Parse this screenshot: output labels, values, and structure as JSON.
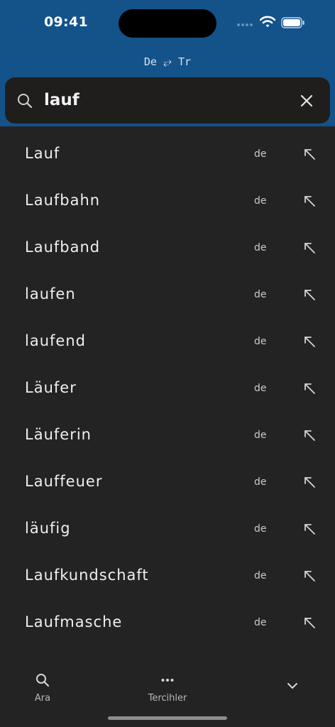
{
  "status_bar": {
    "time": "09:41"
  },
  "header": {
    "language_pair": "De ⥂ Tr"
  },
  "search": {
    "value": "lauf"
  },
  "results": [
    {
      "word": "Lauf",
      "lang": "de"
    },
    {
      "word": "Laufbahn",
      "lang": "de"
    },
    {
      "word": "Laufband",
      "lang": "de"
    },
    {
      "word": "laufen",
      "lang": "de"
    },
    {
      "word": "laufend",
      "lang": "de"
    },
    {
      "word": "Läufer",
      "lang": "de"
    },
    {
      "word": "Läuferin",
      "lang": "de"
    },
    {
      "word": "Lauffeuer",
      "lang": "de"
    },
    {
      "word": "läufig",
      "lang": "de"
    },
    {
      "word": "Laufkundschaft",
      "lang": "de"
    },
    {
      "word": "Laufmasche",
      "lang": "de"
    }
  ],
  "tabbar": {
    "search_label": "Ara",
    "prefs_label": "Tercihler"
  },
  "icons": {
    "search": "search-icon",
    "clear": "close-icon",
    "row_arrow": "arrow-up-left-icon",
    "prefs": "more-dots-icon",
    "collapse": "chevron-down-icon"
  }
}
